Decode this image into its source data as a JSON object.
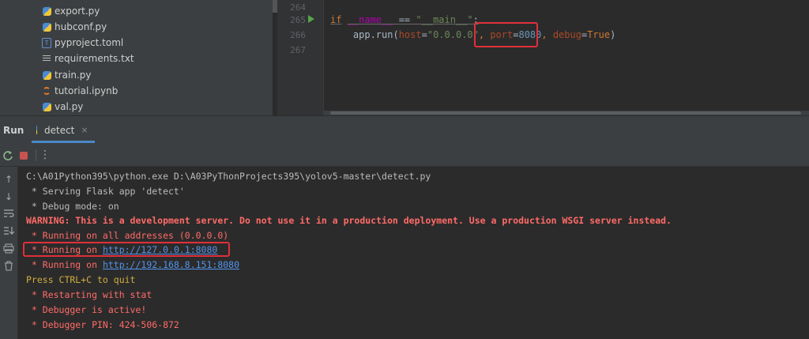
{
  "project_tree": {
    "files": [
      {
        "name": "export.py",
        "icon": "python-file-icon"
      },
      {
        "name": "hubconf.py",
        "icon": "python-file-icon"
      },
      {
        "name": "pyproject.toml",
        "icon": "toml-file-icon"
      },
      {
        "name": "requirements.txt",
        "icon": "text-file-icon"
      },
      {
        "name": "train.py",
        "icon": "python-file-icon"
      },
      {
        "name": "tutorial.ipynb",
        "icon": "notebook-file-icon"
      },
      {
        "name": "val.py",
        "icon": "python-file-icon"
      }
    ]
  },
  "editor": {
    "line_numbers": [
      "264",
      "265",
      "266",
      "267"
    ],
    "line265": {
      "kw_if": "if",
      "name_var": "__name__",
      "op_eq": " == ",
      "main_str": "\"__main__\"",
      "colon": ":"
    },
    "line266": {
      "indent_call": "    app.run(",
      "host_param": "host",
      "eq1": "=",
      "host_val": "\"0.0.0.0\"",
      "comma1": ", ",
      "port_param": "port",
      "eq2": "=",
      "port_val": "8080",
      "comma2": ", ",
      "debug_param": "debug",
      "eq3": "=",
      "debug_val": "True",
      "close": ")"
    }
  },
  "run_window": {
    "title": "Run",
    "tab_label": "detect",
    "tab_close": "×",
    "toolbar": {
      "rerun_icon": "rerun-icon",
      "stop_icon": "stop-icon",
      "more_glyph": "⋮"
    }
  },
  "console": {
    "lines": [
      {
        "text": "C:\\A01Python395\\python.exe D:\\A03PyThonProjects395\\yolov5-master\\detect.py",
        "style": "normal"
      },
      {
        "text": " * Serving Flask app 'detect'",
        "style": "normal"
      },
      {
        "text": " * Debug mode: on",
        "style": "normal"
      },
      {
        "text": "WARNING: This is a development server. Do not use it in a production deployment. Use a production WSGI server instead.",
        "style": "warn"
      },
      {
        "text": " * Running on all addresses (0.0.0.0)",
        "style": "red"
      }
    ],
    "running_local": {
      "prefix": " * Running on ",
      "url": "http://127.0.0.1:8080"
    },
    "running_lan": {
      "prefix": " * Running on ",
      "url": "http://192.168.8.151:8080"
    },
    "tail_lines": [
      {
        "text": "Press CTRL+C to quit",
        "style": "yellow"
      },
      {
        "text": " * Restarting with stat",
        "style": "red"
      },
      {
        "text": " * Debugger is active!",
        "style": "red"
      },
      {
        "text": " * Debugger PIN: 424-506-872",
        "style": "red"
      }
    ]
  },
  "colors": {
    "highlight_box": "#e0303a",
    "warning_text": "#ff6b68",
    "link": "#5394ec",
    "quit_text": "#d0ad3f"
  }
}
